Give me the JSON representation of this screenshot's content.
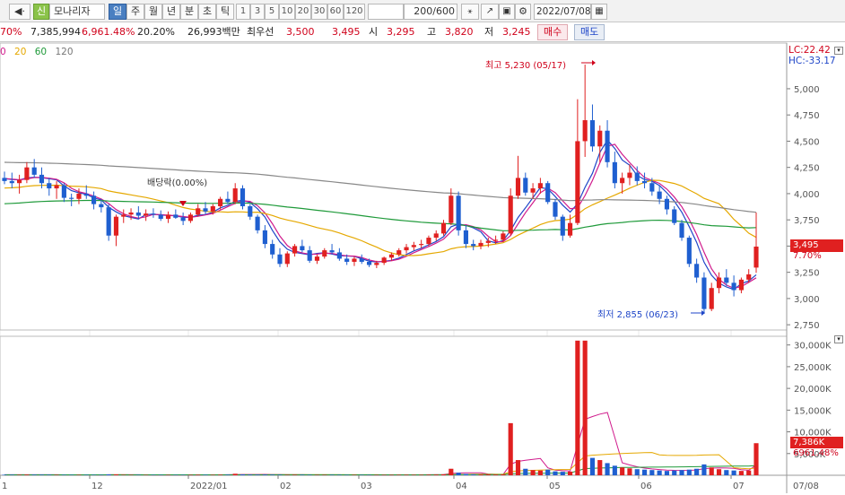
{
  "toolbar": {
    "nav_icon": "◀·",
    "market_badge": "신",
    "stock_name": "모나리자",
    "periods": [
      "일",
      "주",
      "월",
      "년",
      "분",
      "초",
      "틱"
    ],
    "active_period": "일",
    "intervals": [
      "1",
      "3",
      "5",
      "10",
      "20",
      "30",
      "60",
      "120"
    ],
    "count_value": "200",
    "count_total": "/600",
    "date_value": "2022/07/08"
  },
  "info": {
    "change_cut": "70%",
    "volume": "7,385,994",
    "vol_ratio": "6,961.48%",
    "turnover": "20.20%",
    "amount": "26,993백만",
    "pref_label": "최우선",
    "bid1": "3,500",
    "bid2": "3,495",
    "open_label": "시",
    "open": "3,295",
    "high_label": "고",
    "high": "3,820",
    "low_label": "저",
    "low": "3,245",
    "buy_label": "매수",
    "sell_label": "매도"
  },
  "legend": {
    "ma": [
      "0",
      "20",
      "60",
      "120"
    ],
    "colors": [
      "#d01b8c",
      "#e5a800",
      "#1f9a3a",
      "#777777"
    ]
  },
  "price_panel": {
    "lc_label": "LC:22.42",
    "hc_label": "HC:-33.17",
    "y_ticks": [
      5000,
      4750,
      4500,
      4250,
      4000,
      3750,
      3500,
      3250,
      3000,
      2750
    ],
    "current_price": "3,495",
    "current_change": "7.70%",
    "high_annotation": "최고 5,230 (05/17)",
    "low_annotation": "최저 2,855 (06/23)",
    "dividend_annotation": "배당락(0.00%)"
  },
  "volume_panel": {
    "y_ticks": [
      "30,000K",
      "25,000K",
      "20,000K",
      "15,000K",
      "10,000K",
      "5,000K"
    ],
    "current_volume": "7,386K",
    "current_ratio": "6961.48%"
  },
  "x_axis": {
    "labels": [
      "1",
      "12",
      "2022/01",
      "02",
      "03",
      "04",
      "05",
      "06",
      "07",
      "07/08"
    ]
  },
  "chart_data": {
    "type": "candlestick",
    "unit": "KRW",
    "ylim": [
      2700,
      5350
    ],
    "ohlc": [
      [
        4150,
        4210,
        4090,
        4120
      ],
      [
        4120,
        4200,
        4050,
        4100
      ],
      [
        4100,
        4180,
        4000,
        4130
      ],
      [
        4130,
        4300,
        4100,
        4250
      ],
      [
        4250,
        4330,
        4150,
        4180
      ],
      [
        4180,
        4250,
        4050,
        4100
      ],
      [
        4100,
        4150,
        3980,
        4050
      ],
      [
        4050,
        4120,
        3950,
        4080
      ],
      [
        4080,
        4100,
        3920,
        3960
      ],
      [
        3960,
        4000,
        3880,
        3950
      ],
      [
        3950,
        4050,
        3900,
        4000
      ],
      [
        4000,
        4080,
        3950,
        3980
      ],
      [
        3980,
        4020,
        3850,
        3900
      ],
      [
        3900,
        3950,
        3820,
        3870
      ],
      [
        3870,
        3900,
        3550,
        3600
      ],
      [
        3600,
        3800,
        3500,
        3780
      ],
      [
        3780,
        3850,
        3720,
        3800
      ],
      [
        3800,
        3860,
        3750,
        3820
      ],
      [
        3820,
        3880,
        3760,
        3790
      ],
      [
        3790,
        3850,
        3740,
        3810
      ],
      [
        3810,
        3860,
        3770,
        3800
      ],
      [
        3800,
        3840,
        3740,
        3760
      ],
      [
        3760,
        3830,
        3720,
        3800
      ],
      [
        3800,
        3850,
        3760,
        3770
      ],
      [
        3770,
        3820,
        3700,
        3740
      ],
      [
        3740,
        3820,
        3720,
        3800
      ],
      [
        3800,
        3900,
        3780,
        3860
      ],
      [
        3860,
        3920,
        3800,
        3830
      ],
      [
        3830,
        3900,
        3800,
        3880
      ],
      [
        3880,
        3970,
        3850,
        3950
      ],
      [
        3950,
        4020,
        3900,
        3920
      ],
      [
        3920,
        4100,
        3900,
        4050
      ],
      [
        4050,
        4080,
        3850,
        3880
      ],
      [
        3880,
        3900,
        3750,
        3780
      ],
      [
        3780,
        3800,
        3620,
        3650
      ],
      [
        3650,
        3700,
        3480,
        3520
      ],
      [
        3520,
        3560,
        3380,
        3420
      ],
      [
        3420,
        3480,
        3300,
        3330
      ],
      [
        3330,
        3450,
        3300,
        3430
      ],
      [
        3430,
        3520,
        3400,
        3500
      ],
      [
        3500,
        3560,
        3440,
        3460
      ],
      [
        3460,
        3500,
        3340,
        3360
      ],
      [
        3360,
        3420,
        3330,
        3400
      ],
      [
        3400,
        3480,
        3380,
        3460
      ],
      [
        3460,
        3520,
        3420,
        3440
      ],
      [
        3440,
        3480,
        3360,
        3380
      ],
      [
        3380,
        3420,
        3320,
        3350
      ],
      [
        3350,
        3400,
        3310,
        3380
      ],
      [
        3380,
        3420,
        3330,
        3350
      ],
      [
        3350,
        3380,
        3300,
        3320
      ],
      [
        3320,
        3360,
        3290,
        3340
      ],
      [
        3340,
        3400,
        3320,
        3390
      ],
      [
        3390,
        3440,
        3360,
        3420
      ],
      [
        3420,
        3480,
        3400,
        3460
      ],
      [
        3460,
        3520,
        3430,
        3490
      ],
      [
        3490,
        3540,
        3460,
        3510
      ],
      [
        3510,
        3560,
        3480,
        3520
      ],
      [
        3520,
        3600,
        3500,
        3580
      ],
      [
        3580,
        3650,
        3550,
        3620
      ],
      [
        3620,
        3750,
        3600,
        3720
      ],
      [
        3720,
        4050,
        3700,
        3980
      ],
      [
        3980,
        4020,
        3600,
        3650
      ],
      [
        3650,
        3700,
        3480,
        3520
      ],
      [
        3520,
        3560,
        3460,
        3500
      ],
      [
        3500,
        3560,
        3470,
        3530
      ],
      [
        3530,
        3580,
        3490,
        3550
      ],
      [
        3550,
        3600,
        3520,
        3560
      ],
      [
        3560,
        3640,
        3540,
        3620
      ],
      [
        3620,
        4050,
        3600,
        3980
      ],
      [
        3980,
        4360,
        3950,
        4150
      ],
      [
        4150,
        4200,
        3980,
        4010
      ],
      [
        4010,
        4100,
        3950,
        4050
      ],
      [
        4050,
        4150,
        4000,
        4100
      ],
      [
        4100,
        4120,
        3900,
        3920
      ],
      [
        3920,
        3950,
        3750,
        3780
      ],
      [
        3780,
        3800,
        3550,
        3600
      ],
      [
        3600,
        3800,
        3580,
        3720
      ],
      [
        3720,
        4900,
        3700,
        4500
      ],
      [
        4500,
        5230,
        4350,
        4700
      ],
      [
        4700,
        4850,
        4400,
        4450
      ],
      [
        4450,
        4650,
        4300,
        4600
      ],
      [
        4600,
        4700,
        4250,
        4300
      ],
      [
        4300,
        4400,
        4050,
        4100
      ],
      [
        4100,
        4200,
        4000,
        4150
      ],
      [
        4150,
        4280,
        4080,
        4200
      ],
      [
        4200,
        4260,
        4080,
        4120
      ],
      [
        4120,
        4200,
        4050,
        4100
      ],
      [
        4100,
        4150,
        3980,
        4020
      ],
      [
        4020,
        4080,
        3900,
        3950
      ],
      [
        3950,
        3980,
        3800,
        3850
      ],
      [
        3850,
        3880,
        3700,
        3720
      ],
      [
        3720,
        3750,
        3550,
        3580
      ],
      [
        3580,
        3600,
        3300,
        3330
      ],
      [
        3330,
        3380,
        3150,
        3200
      ],
      [
        3200,
        3250,
        2855,
        2900
      ],
      [
        2900,
        3150,
        2880,
        3100
      ],
      [
        3100,
        3250,
        3050,
        3200
      ],
      [
        3200,
        3280,
        3120,
        3150
      ],
      [
        3150,
        3220,
        3020,
        3080
      ],
      [
        3080,
        3200,
        3050,
        3180
      ],
      [
        3180,
        3280,
        3150,
        3230
      ],
      [
        3295,
        3820,
        3245,
        3495
      ]
    ],
    "volume_k": [
      120,
      110,
      100,
      150,
      130,
      120,
      110,
      100,
      95,
      90,
      100,
      95,
      90,
      85,
      200,
      180,
      90,
      85,
      80,
      85,
      80,
      78,
      85,
      80,
      80,
      90,
      120,
      110,
      100,
      130,
      120,
      350,
      200,
      150,
      140,
      160,
      130,
      110,
      100,
      120,
      110,
      100,
      95,
      100,
      100,
      95,
      90,
      95,
      90,
      85,
      85,
      95,
      100,
      110,
      120,
      110,
      110,
      130,
      150,
      220,
      1500,
      600,
      300,
      200,
      180,
      170,
      160,
      200,
      12000,
      3500,
      1500,
      1200,
      1100,
      1300,
      900,
      800,
      850,
      31000,
      31000,
      4000,
      3500,
      2800,
      2200,
      1800,
      1600,
      1400,
      1300,
      1200,
      1100,
      1000,
      1100,
      1200,
      1300,
      1500,
      2500,
      1800,
      1400,
      1200,
      1100,
      1000,
      1100,
      7386
    ]
  }
}
